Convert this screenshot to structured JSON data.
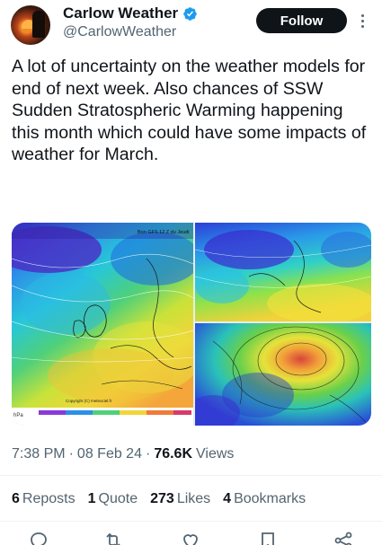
{
  "author": {
    "display_name": "Carlow Weather",
    "handle": "@CarlowWeather",
    "verified": true,
    "avatar_icon": "sunset-tree-avatar"
  },
  "follow_button": {
    "label": "Follow"
  },
  "tweet": {
    "text": "A lot of uncertainty on the weather models for end of next week. Also chances of SSW Sudden Stratospheric Warming happening this month which could have some impacts of weather for March."
  },
  "media": {
    "left_image": {
      "header": "Bon GFS 12 Z du Jeudi",
      "unit": "hPa",
      "copyright": "Copyright (C) meteociel.fr"
    }
  },
  "meta": {
    "time": "7:38 PM",
    "separator": "·",
    "date": "08 Feb 24",
    "views_count": "76.6K",
    "views_label": "Views"
  },
  "stats": {
    "reposts_count": "6",
    "reposts_label": "Reposts",
    "quotes_count": "1",
    "quotes_label": "Quote",
    "likes_count": "273",
    "likes_label": "Likes",
    "bookmarks_count": "4",
    "bookmarks_label": "Bookmarks"
  },
  "colors": {
    "text_primary": "#0f1419",
    "text_secondary": "#536471",
    "verified_blue": "#1d9bf0",
    "follow_bg": "#0f1419"
  },
  "action_icons": [
    "reply-icon",
    "repost-icon",
    "like-icon",
    "bookmark-icon",
    "share-icon"
  ]
}
